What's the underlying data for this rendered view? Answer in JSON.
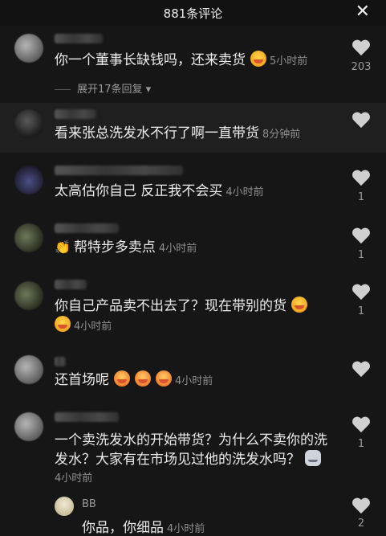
{
  "header": {
    "title": "881条评论",
    "close_icon": "close-icon"
  },
  "comments": [
    {
      "text": "你一个董事长缺钱吗，还来卖货",
      "time": "5小时前",
      "likes": "203",
      "expand": "展开17条回复"
    },
    {
      "text": "看来张总洗发水不行了啊一直带货",
      "time": "8分钟前",
      "likes": ""
    },
    {
      "text": "太高估你自己 反正我不会买",
      "time": "4小时前",
      "likes": "1"
    },
    {
      "text": "帮特步多卖点",
      "time": "4小时前",
      "likes": "1"
    },
    {
      "text_line1": "你自己产品卖不出去了？现在带别的货",
      "time": "4小时前",
      "likes": "1"
    },
    {
      "text": "还首场呢",
      "time": "4小时前",
      "likes": ""
    },
    {
      "text_line1": "一个卖洗发水的开始带货？为什么不卖你的洗",
      "text_line2": "发水？大家有在市场见过他的洗发水吗？",
      "time": "4小时前",
      "likes": "1"
    }
  ],
  "reply": {
    "name": "BB",
    "text": "你品，你细品",
    "time": "4小时前",
    "likes": "2"
  }
}
